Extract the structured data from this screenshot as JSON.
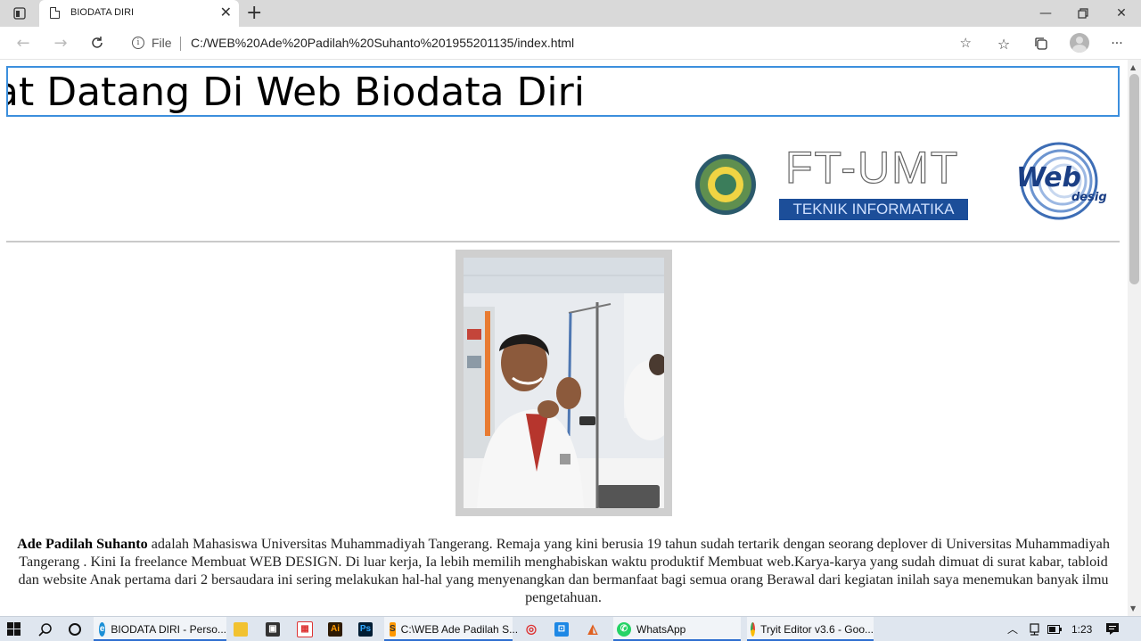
{
  "browser": {
    "tab_title": "BIODATA DIRI",
    "address_prefix": "File",
    "url": "C:/WEB%20Ade%20Padilah%20Suhanto%201955201135/index.html"
  },
  "page": {
    "marquee_text": "Selamat Datang Di Web Biodata Diri",
    "logo_ft_text": "FT-UMT",
    "logo_band_text": "TEKNIK INFORMATIKA",
    "logo_web_text": "Web",
    "logo_web_sub": "desig",
    "bio_name": "Ade Padilah Suhanto",
    "bio_text": " adalah Mahasiswa Universitas Muhammadiyah Tangerang. Remaja yang kini berusia 19 tahun sudah tertarik dengan seorang deplover di Universitas Muhammadiyah Tangerang . Kini Ia freelance Membuat WEB DESIGN. Di luar kerja, Ia lebih memilih menghabiskan waktu produktif Membuat web.Karya-karya yang sudah dimuat di surat kabar, tabloid dan website Anak pertama dari 2 bersaudara ini sering melakukan hal-hal yang menyenangkan dan bermanfaat bagi semua orang Berawal dari kegiatan inilah saya menemukan banyak ilmu pengetahuan."
  },
  "taskbar": {
    "items": [
      {
        "label": "BIODATA DIRI - Perso..."
      },
      {
        "label": "C:\\WEB Ade Padilah S..."
      },
      {
        "label": "WhatsApp"
      },
      {
        "label": "Tryit Editor v3.6 - Goo..."
      }
    ],
    "clock": "1:23"
  },
  "colors": {
    "accent": "#3c8fdd",
    "taskbar_underline": "#2f6fd0",
    "band": "#1c4e99"
  }
}
